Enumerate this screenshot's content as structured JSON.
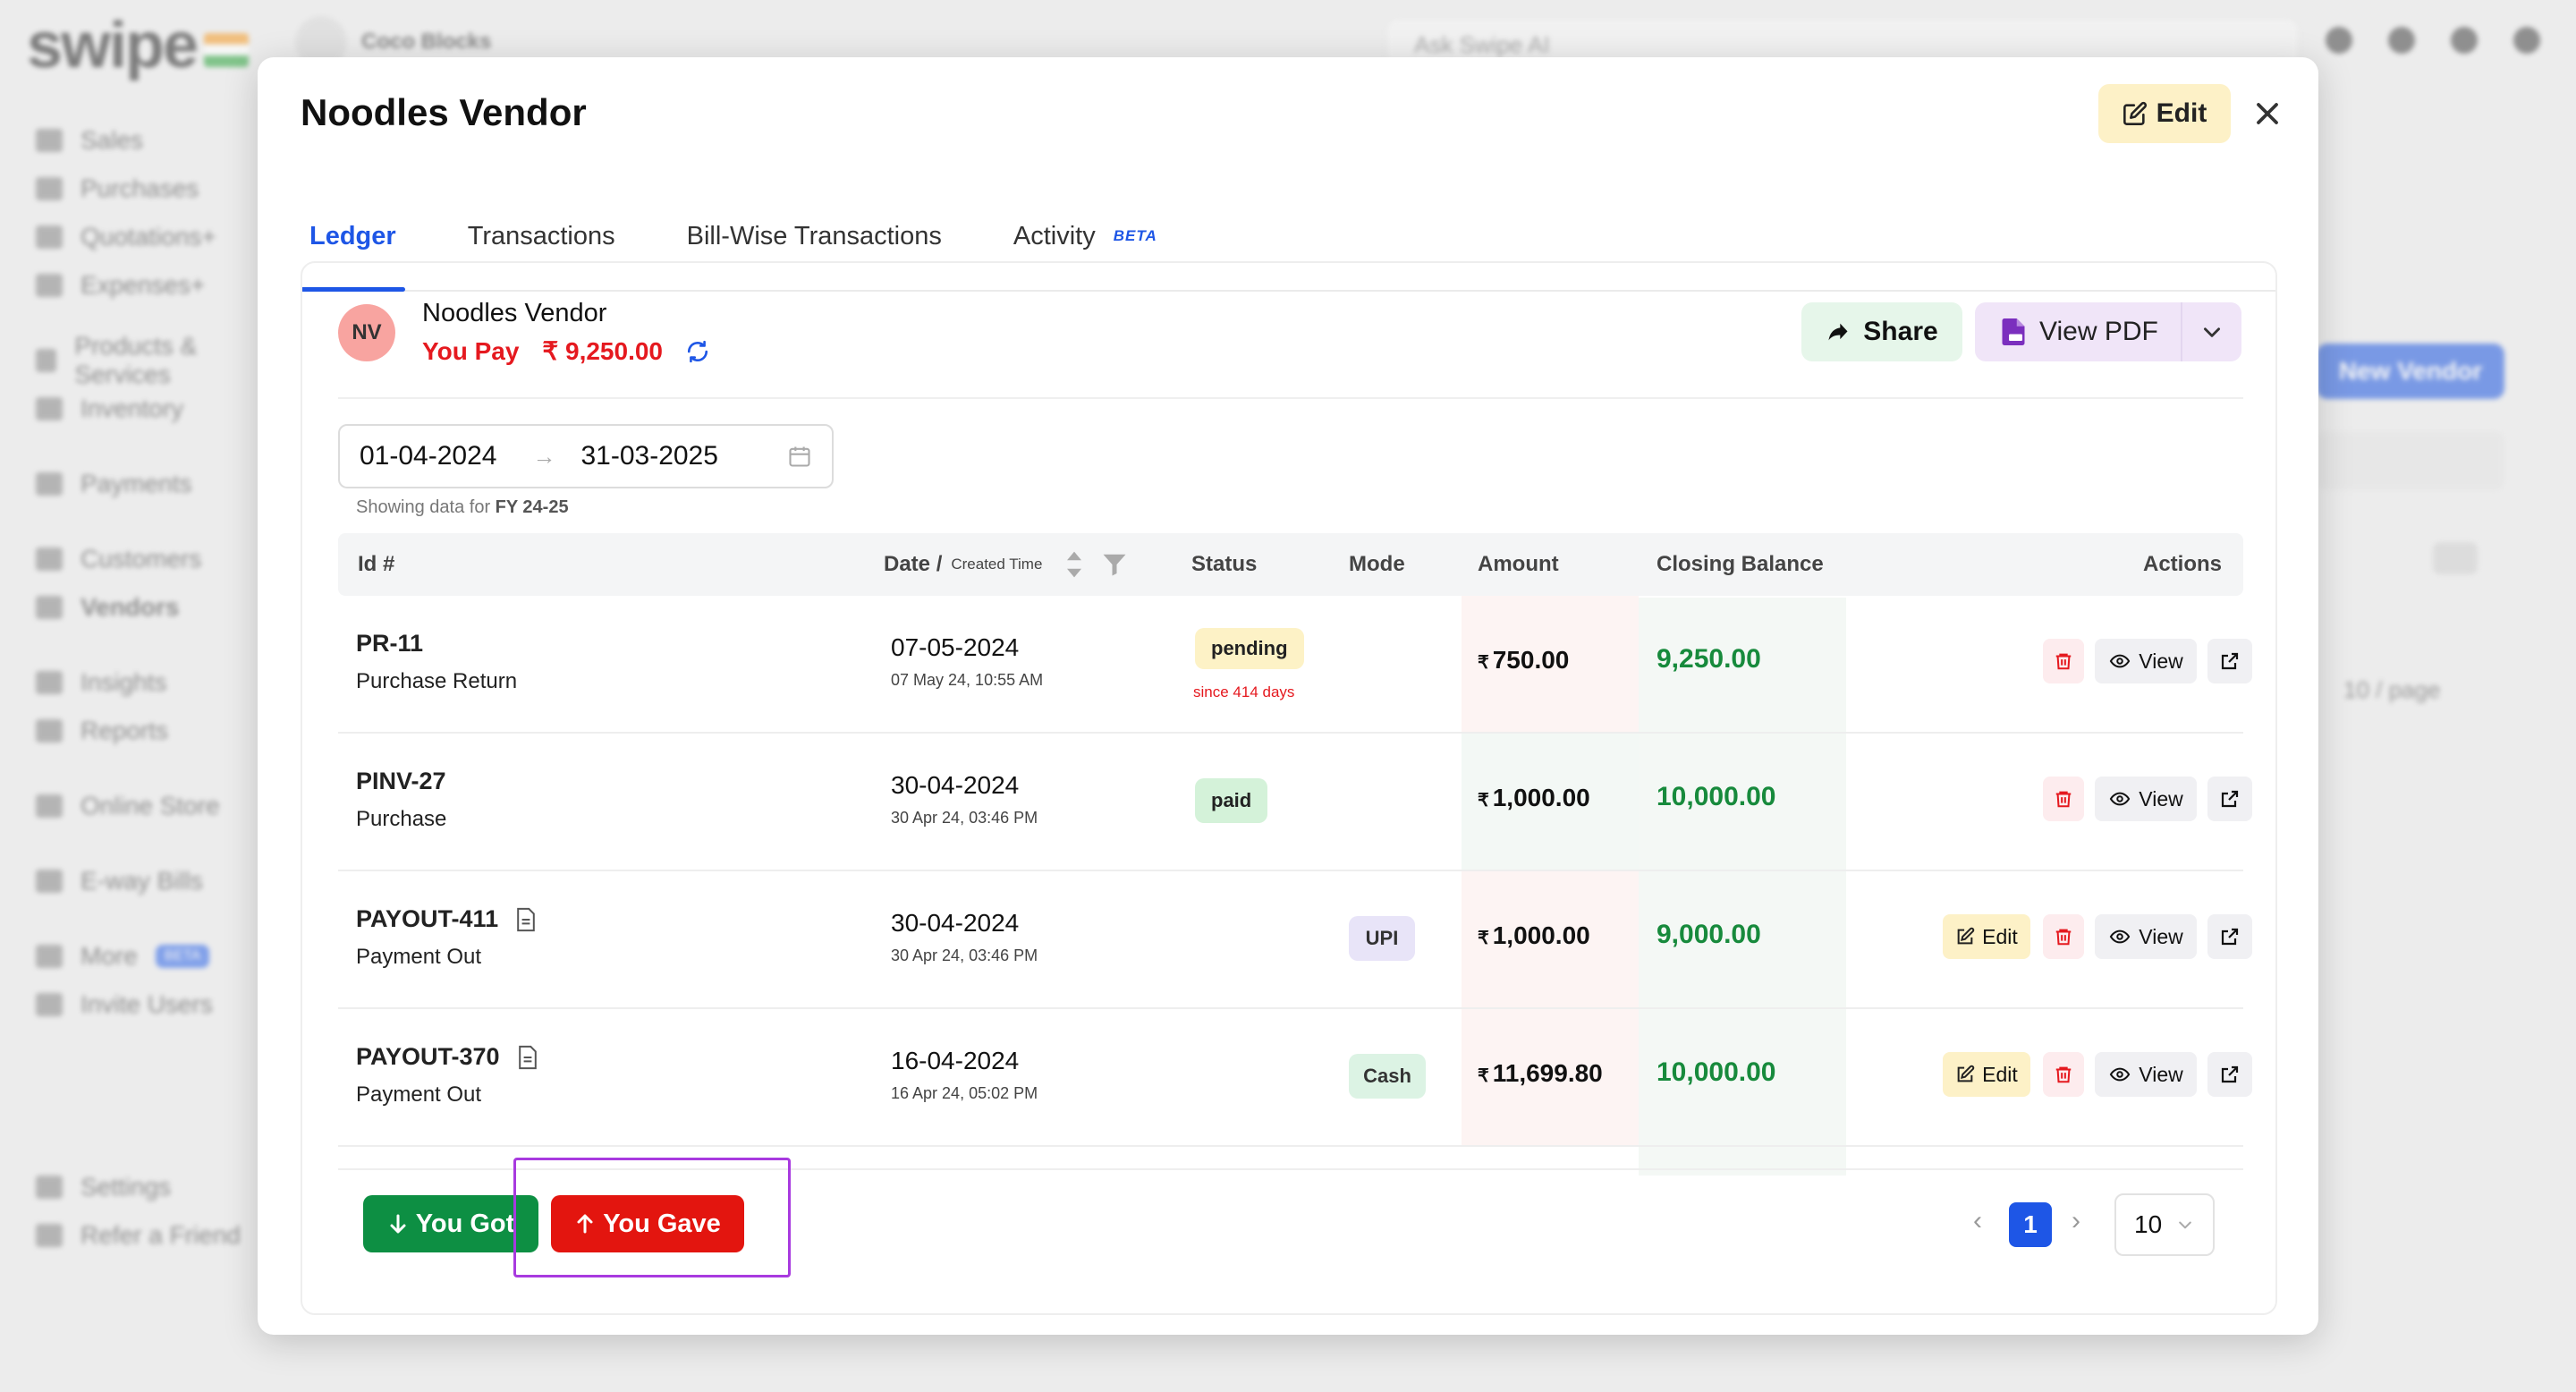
{
  "background": {
    "logo": "swipe",
    "company": "Coco Blocks",
    "search_placeholder": "Ask Swipe AI",
    "sidebar": [
      "Sales",
      "Purchases",
      "Quotations+",
      "Expenses+",
      "Products & Services",
      "Inventory",
      "Payments",
      "Customers",
      "Vendors",
      "Insights",
      "Reports",
      "Online Store",
      "E-way Bills",
      "More",
      "Invite Users",
      "Settings",
      "Refer a Friend"
    ],
    "more_badge": "BETA",
    "new_vendor": "New Vendor",
    "per_page": "10 / page"
  },
  "modal": {
    "title": "Noodles Vendor",
    "edit_label": "Edit",
    "tabs": [
      {
        "label": "Ledger",
        "active": true
      },
      {
        "label": "Transactions"
      },
      {
        "label": "Bill-Wise Transactions"
      },
      {
        "label": "Activity",
        "badge": "BETA"
      }
    ],
    "vendor": {
      "initials": "NV",
      "name": "Noodles Vendor",
      "pay_label": "You Pay",
      "pay_amount": "₹ 9,250.00"
    },
    "share_label": "Share",
    "view_pdf_label": "View PDF",
    "date_from": "01-04-2024",
    "date_to": "31-03-2025",
    "showing_prefix": "Showing data for",
    "showing_fy": "FY 24-25",
    "columns": {
      "id": "Id #",
      "date": "Date /",
      "date_sub": "Created Time",
      "status": "Status",
      "mode": "Mode",
      "amount": "Amount",
      "closing_balance": "Closing Balance",
      "actions": "Actions"
    },
    "rows": [
      {
        "id": "PR-11",
        "type": "Purchase Return",
        "date": "07-05-2024",
        "time": "07 May 24, 10:55 AM",
        "status": "pending",
        "since": "since 414 days",
        "mode": "",
        "amount": "750.00",
        "balance": "9,250.00"
      },
      {
        "id": "PINV-27",
        "type": "Purchase",
        "date": "30-04-2024",
        "time": "30 Apr 24, 03:46 PM",
        "status": "paid",
        "mode": "",
        "amount": "1,000.00",
        "balance": "10,000.00"
      },
      {
        "id": "PAYOUT-411",
        "type": "Payment Out",
        "date": "30-04-2024",
        "time": "30 Apr 24, 03:46 PM",
        "status": "",
        "mode": "UPI",
        "amount": "1,000.00",
        "balance": "9,000.00"
      },
      {
        "id": "PAYOUT-370",
        "type": "Payment Out",
        "date": "16-04-2024",
        "time": "16 Apr 24, 05:02 PM",
        "status": "",
        "mode": "Cash",
        "amount": "11,699.80",
        "balance": "10,000.00"
      }
    ],
    "rupee": "₹",
    "action_edit": "Edit",
    "action_view": "View",
    "you_got": "You Got",
    "you_gave": "You Gave",
    "current_page": "1",
    "page_size": "10"
  },
  "colors": {
    "accent": "#1e56e6",
    "pay_red": "#e5191f",
    "balance_green": "#178a3c",
    "you_got_green": "#0d8f43",
    "you_gave_red": "#e3150f",
    "highlight": "#a83adf"
  }
}
